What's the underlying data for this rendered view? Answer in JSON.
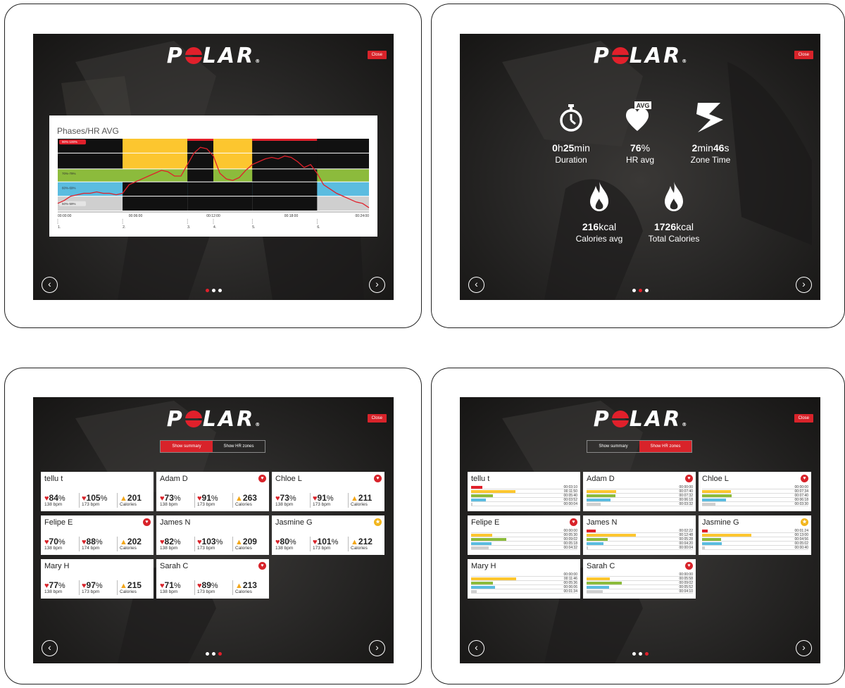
{
  "brand": {
    "logo_text_1": "P",
    "logo_text_2": "LAR",
    "reg": "®"
  },
  "close_label": "Close",
  "nav": {
    "prev": "‹",
    "next": "›"
  },
  "colors": {
    "accent": "#d8232a",
    "zone_red": "#e1202b",
    "zone_yellow": "#fcc62f",
    "zone_green": "#8cbb3c",
    "zone_blue": "#5bbce0",
    "zone_gray": "#cfcfcf"
  },
  "screen1": {
    "title": "Phases/HR AVG",
    "zones": [
      "90%-100%",
      "70%-79%",
      "60%-69%",
      "50%-59%"
    ],
    "time_labels": [
      "00:00:00",
      "00:06:00",
      "00:12:00",
      "00:18:00",
      "00:24:00"
    ],
    "phases": [
      "1.",
      "2.",
      "3.",
      "4.",
      "5.",
      "6."
    ]
  },
  "chart_data": {
    "type": "line",
    "title": "Phases/HR AVG",
    "xlabel": "",
    "ylabel": "",
    "x_unit": "minutes",
    "x_ticks": [
      "00:00:00",
      "00:06:00",
      "00:12:00",
      "00:18:00",
      "00:24:00"
    ],
    "phase_starts_min": [
      0,
      5,
      10,
      12,
      15,
      20
    ],
    "phase_zones": [
      "gray",
      "yellow",
      "red",
      "yellow",
      "red",
      "blue"
    ],
    "series": [
      {
        "x": [
          0,
          0.5,
          1,
          1.5,
          2,
          2.5,
          3,
          3.5,
          4,
          4.5,
          5,
          5.5,
          6,
          6.5,
          7,
          7.5,
          8,
          8.5,
          9,
          9.5,
          10,
          10.5,
          11,
          11.5,
          12,
          12.5,
          13,
          13.5,
          14,
          14.5,
          15,
          15.5,
          16,
          16.5,
          17,
          17.5,
          18,
          18.5,
          19,
          19.5,
          20,
          20.5,
          21,
          21.5,
          22,
          22.5,
          23,
          23.5,
          24
        ],
        "values": [
          55,
          57,
          60,
          61,
          62,
          62,
          63,
          62,
          62,
          61,
          62,
          68,
          70,
          72,
          74,
          76,
          78,
          77,
          74,
          74,
          82,
          90,
          94,
          93,
          88,
          76,
          72,
          71,
          73,
          78,
          82,
          84,
          86,
          87,
          86,
          88,
          87,
          84,
          80,
          82,
          76,
          68,
          65,
          62,
          60,
          58,
          56,
          55,
          52
        ]
      }
    ]
  },
  "screen2": {
    "avg_badge": "AVG",
    "stats": [
      {
        "name": "duration",
        "value_parts": [
          "0",
          "h",
          "25",
          "min"
        ],
        "label": "Duration"
      },
      {
        "name": "hr-avg",
        "value_parts": [
          "76",
          "%"
        ],
        "label": "HR avg"
      },
      {
        "name": "zone-time",
        "value_parts": [
          "2",
          "min",
          "46",
          "s"
        ],
        "label": "Zone Time"
      },
      {
        "name": "calories-avg",
        "value_parts": [
          "216",
          "kcal"
        ],
        "label": "Calories avg"
      },
      {
        "name": "total-calories",
        "value_parts": [
          "1726",
          "kcal"
        ],
        "label": "Total Calories"
      }
    ]
  },
  "screen3": {
    "tabs": {
      "summary": "Show summary",
      "zones": "Show HR zones"
    },
    "calories_label": "Calories",
    "participants": [
      {
        "name": "tellu t",
        "badge": "",
        "avg_pct": "84",
        "avg_bpm": "138 bpm",
        "max_pct": "105",
        "max_bpm": "173 bpm",
        "cal": "201"
      },
      {
        "name": "Adam D",
        "badge": "red",
        "avg_pct": "73",
        "avg_bpm": "138 bpm",
        "max_pct": "91",
        "max_bpm": "173 bpm",
        "cal": "263"
      },
      {
        "name": "Chloe L",
        "badge": "red",
        "avg_pct": "73",
        "avg_bpm": "138 bpm",
        "max_pct": "91",
        "max_bpm": "173 bpm",
        "cal": "211"
      },
      {
        "name": "Felipe E",
        "badge": "red",
        "avg_pct": "70",
        "avg_bpm": "138 bpm",
        "max_pct": "88",
        "max_bpm": "174 bpm",
        "cal": "202"
      },
      {
        "name": "James N",
        "badge": "",
        "avg_pct": "82",
        "avg_bpm": "138 bpm",
        "max_pct": "103",
        "max_bpm": "173 bpm",
        "cal": "209"
      },
      {
        "name": "Jasmine G",
        "badge": "gold",
        "avg_pct": "80",
        "avg_bpm": "138 bpm",
        "max_pct": "101",
        "max_bpm": "173 bpm",
        "cal": "212"
      },
      {
        "name": "Mary H",
        "badge": "",
        "avg_pct": "77",
        "avg_bpm": "138 bpm",
        "max_pct": "97",
        "max_bpm": "173 bpm",
        "cal": "215"
      },
      {
        "name": "Sarah C",
        "badge": "red",
        "avg_pct": "71",
        "avg_bpm": "138 bpm",
        "max_pct": "89",
        "max_bpm": "173 bpm",
        "cal": "213"
      }
    ]
  },
  "screen4": {
    "participants": [
      {
        "name": "tellu t",
        "badge": "",
        "times": [
          "00:03:10",
          "00:11:50",
          "00:05:40",
          "00:03:52",
          "00:00:04"
        ],
        "fractions": [
          0.23,
          0.9,
          0.44,
          0.3,
          0.02
        ]
      },
      {
        "name": "Adam D",
        "badge": "red",
        "times": [
          "00:00:00",
          "00:07:40",
          "00:07:32",
          "00:06:18",
          "00:03:32"
        ],
        "fractions": [
          0,
          0.6,
          0.59,
          0.49,
          0.28
        ]
      },
      {
        "name": "Chloe L",
        "badge": "red",
        "times": [
          "00:00:00",
          "00:07:34",
          "00:07:40",
          "00:06:18",
          "00:03:30"
        ],
        "fractions": [
          0,
          0.59,
          0.6,
          0.49,
          0.27
        ]
      },
      {
        "name": "Felipe E",
        "badge": "red",
        "times": [
          "00:00:00",
          "00:05:30",
          "00:09:02",
          "00:05:18",
          "00:04:32"
        ],
        "fractions": [
          0,
          0.43,
          0.71,
          0.41,
          0.35
        ]
      },
      {
        "name": "James N",
        "badge": "",
        "times": [
          "00:02:22",
          "00:12:48",
          "00:05:28",
          "00:04:20",
          "00:00:04"
        ],
        "fractions": [
          0.19,
          1.0,
          0.43,
          0.34,
          0.02
        ]
      },
      {
        "name": "Jasmine G",
        "badge": "gold",
        "times": [
          "00:01:24",
          "00:13:00",
          "00:04:56",
          "00:05:02",
          "00:00:40"
        ],
        "fractions": [
          0.11,
          1.0,
          0.39,
          0.4,
          0.05
        ]
      },
      {
        "name": "Mary H",
        "badge": "",
        "times": [
          "00:00:00",
          "00:11:46",
          "00:05:36",
          "00:06:06",
          "00:01:34"
        ],
        "fractions": [
          0,
          0.92,
          0.44,
          0.48,
          0.12
        ]
      },
      {
        "name": "Sarah C",
        "badge": "red",
        "times": [
          "00:00:00",
          "00:05:58",
          "00:09:02",
          "00:05:52",
          "00:04:10"
        ],
        "fractions": [
          0,
          0.47,
          0.71,
          0.46,
          0.33
        ]
      }
    ]
  }
}
